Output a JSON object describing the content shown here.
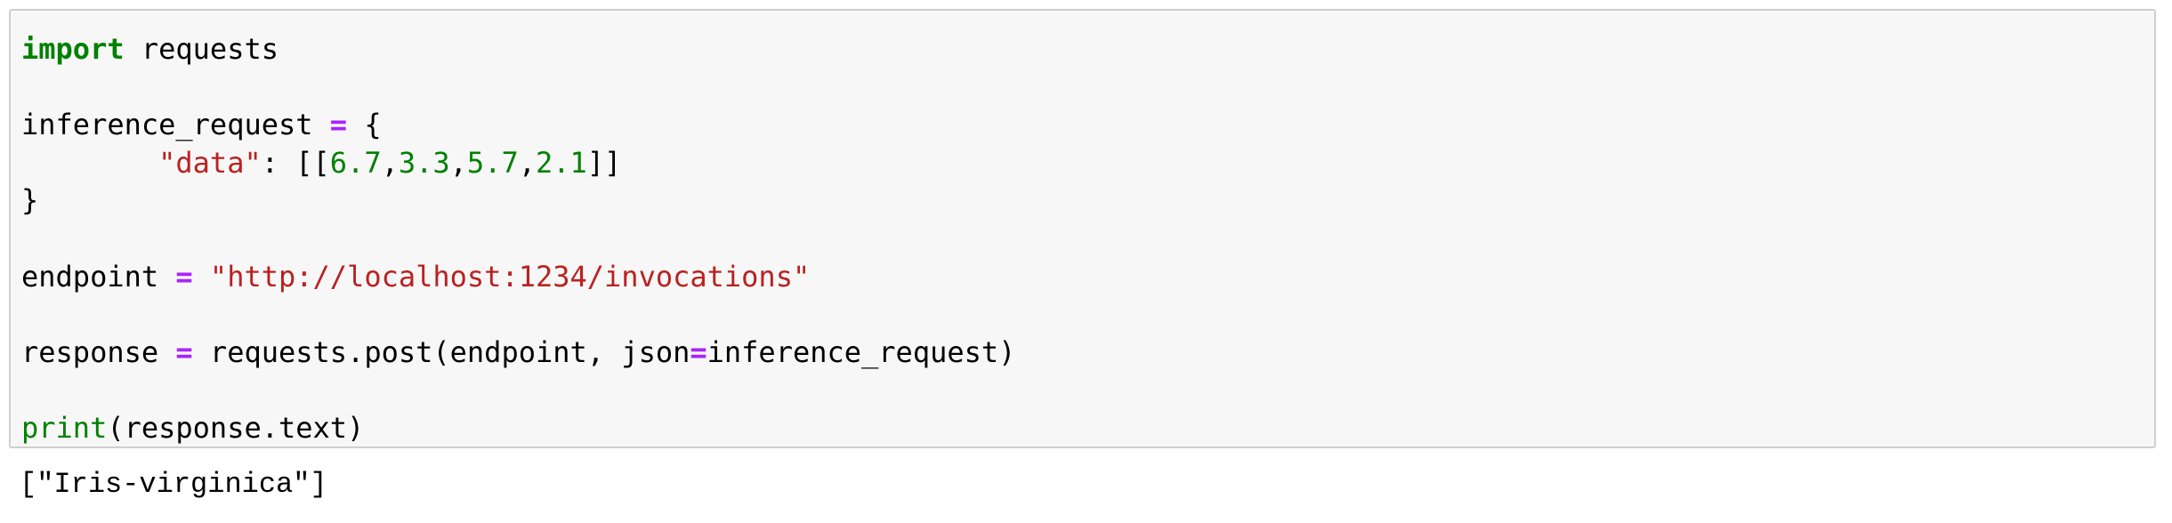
{
  "cell": {
    "code": {
      "import_kw": "import",
      "import_mod": " requests",
      "var_req": "inference_request",
      "eq": "=",
      "brace_open": " {",
      "indent": "        ",
      "data_key": "\"data\"",
      "colon_open": ": [[",
      "nums": [
        "6.7",
        "3.3",
        "5.7",
        "2.1"
      ],
      "comma": ",",
      "close_list": "]]",
      "brace_close": "}",
      "var_endpoint": "endpoint",
      "endpoint_url": "\"http://localhost:1234/invocations\"",
      "var_response": "response",
      "post_call": " requests.post(endpoint, json",
      "post_arg": "inference_request)",
      "print_fn": "print",
      "print_arg": "(response.text)"
    }
  },
  "output": {
    "text": "[\"Iris-virginica\"]"
  },
  "colors": {
    "keyword": "#008000",
    "operator": "#aa22ff",
    "string": "#ba2121",
    "number": "#008000",
    "cell_bg": "#f7f7f7"
  }
}
